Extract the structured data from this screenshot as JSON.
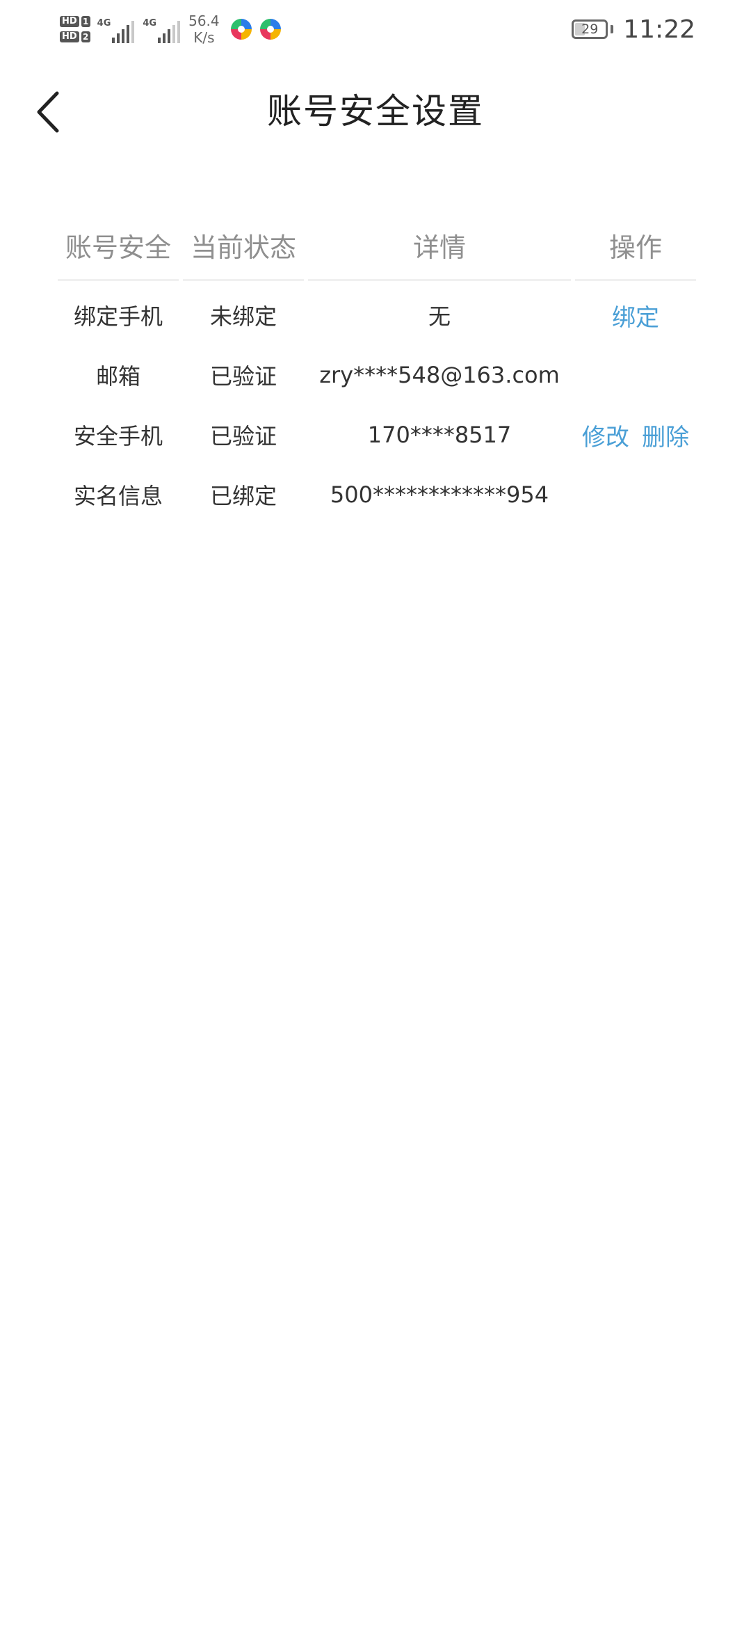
{
  "status_bar": {
    "sim1": "HD",
    "sim1_num": "1",
    "sim2": "HD",
    "sim2_num": "2",
    "network1": "4G",
    "network2": "4G",
    "speed_value": "56.4",
    "speed_unit": "K/s",
    "battery_level": "29",
    "time": "11:22",
    "icons": [
      "sim-hd-icon",
      "signal-strength-icon",
      "app-notification-icon"
    ]
  },
  "header": {
    "title": "账号安全设置",
    "back_icon": "back-arrow-icon"
  },
  "table": {
    "headers": [
      "账号安全",
      "当前状态",
      "详情",
      "操作"
    ],
    "rows": [
      {
        "item": "绑定手机",
        "status": "未绑定",
        "detail": "无",
        "actions": [
          "绑定"
        ]
      },
      {
        "item": "邮箱",
        "status": "已验证",
        "detail": "zry****548@163.com",
        "actions": []
      },
      {
        "item": "安全手机",
        "status": "已验证",
        "detail": "170****8517",
        "actions": [
          "修改",
          "删除"
        ]
      },
      {
        "item": "实名信息",
        "status": "已绑定",
        "detail": "500************954",
        "actions": []
      }
    ]
  },
  "colors": {
    "action": "#4a9fd6",
    "header_text": "#8f8f8f",
    "body_text": "#333333"
  }
}
